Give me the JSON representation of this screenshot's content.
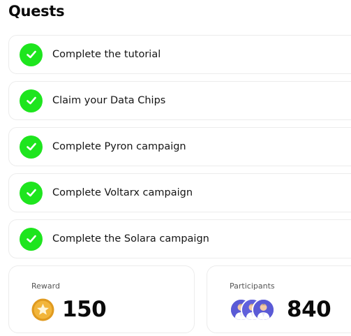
{
  "page": {
    "title": "Quests"
  },
  "quests": [
    {
      "label": "Complete the tutorial",
      "status": "completed",
      "icon": "check-circle-icon"
    },
    {
      "label": "Claim your Data Chips",
      "status": "completed",
      "icon": "check-circle-icon"
    },
    {
      "label": "Complete Pyron campaign",
      "status": "completed",
      "icon": "check-circle-icon"
    },
    {
      "label": "Complete Voltarx campaign",
      "status": "completed",
      "icon": "check-circle-icon"
    },
    {
      "label": "Complete the Solara campaign",
      "status": "completed",
      "icon": "check-circle-icon"
    }
  ],
  "stats": {
    "reward": {
      "label": "Reward",
      "value": "150",
      "icon": "gold-star-coin-icon"
    },
    "participants": {
      "label": "Participants",
      "value": "840",
      "icon": "participant-avatars-icon"
    }
  },
  "colors": {
    "check_green": "#1ee51e",
    "coin_gold": "#f2b53a",
    "avatar_purple": "#5a5ad6",
    "card_border": "#ececec"
  }
}
